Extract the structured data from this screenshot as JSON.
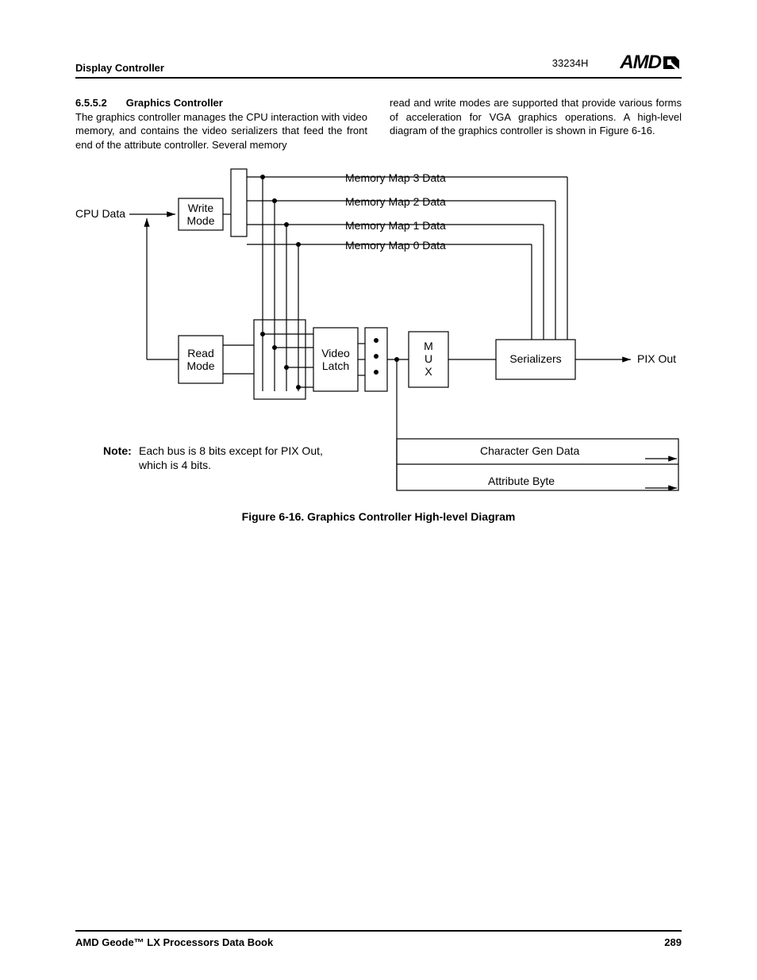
{
  "header": {
    "left": "Display Controller",
    "doc_num": "33234H",
    "logo_text": "AMD"
  },
  "section": {
    "number": "6.5.5.2",
    "title": "Graphics Controller"
  },
  "body": {
    "col1": "The graphics controller manages the CPU interaction with video memory, and contains the video serializers that feed the front end of the attribute controller. Several memory",
    "col2": "read and write modes are supported that provide various forms of acceleration for VGA graphics operations. A high-level diagram of the graphics controller is shown in Figure 6-16."
  },
  "diagram": {
    "cpu_data": "CPU Data",
    "write_mode": "Write\nMode",
    "read_mode": "Read\nMode",
    "mem_map3": "Memory Map 3 Data",
    "mem_map2": "Memory Map 2 Data",
    "mem_map1": "Memory Map 1 Data",
    "mem_map0": "Memory Map 0 Data",
    "video_latch": "Video\nLatch",
    "mux": "M\nU\nX",
    "serializers": "Serializers",
    "pix_out": "PIX Out",
    "char_gen": "Character Gen Data",
    "attr_byte": "Attribute Byte",
    "note_label": "Note:",
    "note_text": "Each bus is 8 bits except for PIX Out, which is 4 bits."
  },
  "figure_caption": "Figure 6-16.  Graphics Controller High-level Diagram",
  "footer": {
    "left": "AMD Geode™ LX Processors Data Book",
    "right": "289"
  }
}
